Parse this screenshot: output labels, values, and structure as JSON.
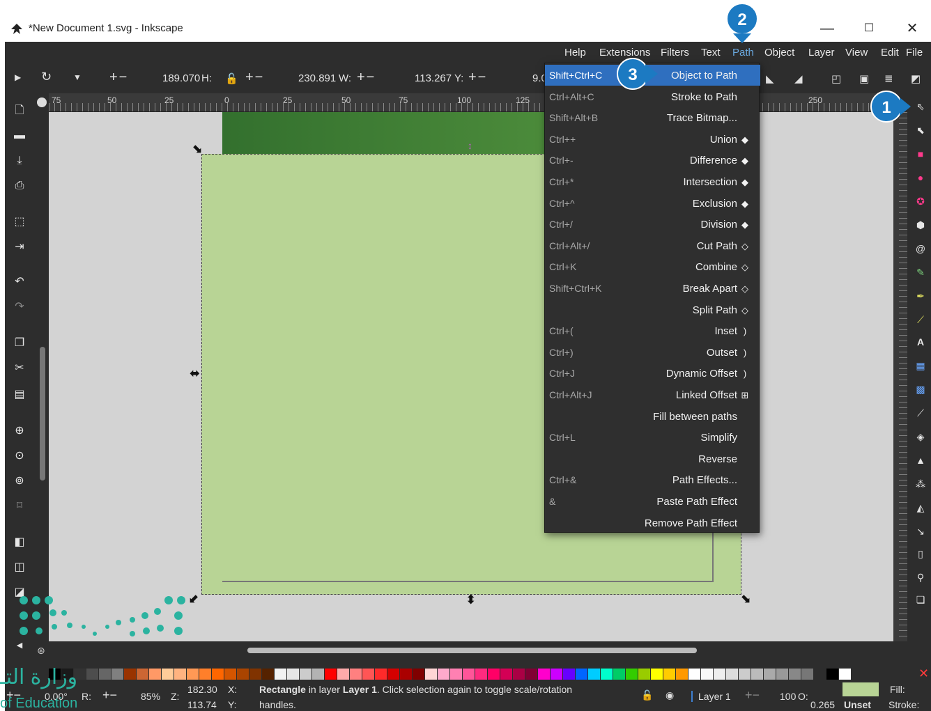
{
  "window": {
    "title": "*New Document 1.svg - Inkscape",
    "minimize": "—",
    "maximize": "☐",
    "close": "✕"
  },
  "menubar": {
    "items": [
      "Help",
      "Extensions",
      "Filters",
      "Text",
      "Path",
      "Object",
      "Layer",
      "View",
      "Edit",
      "File"
    ]
  },
  "toolcontrols": {
    "h_value": "189.070",
    "h_label": "H:",
    "w_value": "230.891",
    "w_label": "W:",
    "y_value": "113.267",
    "y_label": "Y:",
    "x_value_partial": "9.0",
    "plusminus": "+−"
  },
  "ruler": {
    "labels": [
      "75",
      "50",
      "25",
      "0",
      "25",
      "50",
      "75",
      "100",
      "125",
      "250"
    ]
  },
  "path_menu": {
    "items": [
      {
        "shortcut": "Shift+Ctrl+C",
        "label": "Object to Path",
        "icon": ""
      },
      {
        "shortcut": "Ctrl+Alt+C",
        "label": "Stroke to Path",
        "icon": ""
      },
      {
        "shortcut": "Shift+Alt+B",
        "label": "Trace Bitmap...",
        "icon": ""
      },
      {
        "shortcut": "Ctrl++",
        "label": "Union",
        "icon": "◆"
      },
      {
        "shortcut": "Ctrl+-",
        "label": "Difference",
        "icon": "◆"
      },
      {
        "shortcut": "Ctrl+*",
        "label": "Intersection",
        "icon": "◆"
      },
      {
        "shortcut": "Ctrl+^",
        "label": "Exclusion",
        "icon": "◆"
      },
      {
        "shortcut": "Ctrl+/",
        "label": "Division",
        "icon": "◆"
      },
      {
        "shortcut": "Ctrl+Alt+/",
        "label": "Cut Path",
        "icon": "◇"
      },
      {
        "shortcut": "Ctrl+K",
        "label": "Combine",
        "icon": "◇"
      },
      {
        "shortcut": "Shift+Ctrl+K",
        "label": "Break Apart",
        "icon": "◇"
      },
      {
        "shortcut": "",
        "label": "Split Path",
        "icon": "◇"
      },
      {
        "shortcut": "Ctrl+(",
        "label": "Inset",
        "icon": ")"
      },
      {
        "shortcut": "Ctrl+)",
        "label": "Outset",
        "icon": ")"
      },
      {
        "shortcut": "Ctrl+J",
        "label": "Dynamic Offset",
        "icon": ")"
      },
      {
        "shortcut": "Ctrl+Alt+J",
        "label": "Linked Offset",
        "icon": "⊞"
      },
      {
        "shortcut": "",
        "label": "Fill between paths",
        "icon": ""
      },
      {
        "shortcut": "Ctrl+L",
        "label": "Simplify",
        "icon": ""
      },
      {
        "shortcut": "",
        "label": "Reverse",
        "icon": ""
      },
      {
        "shortcut": "Ctrl+&",
        "label": "Path Effects...",
        "icon": ""
      },
      {
        "shortcut": "&",
        "label": "Paste Path Effect",
        "icon": ""
      },
      {
        "shortcut": "",
        "label": "Remove Path Effect",
        "icon": ""
      }
    ]
  },
  "callouts": {
    "one": "1",
    "two": "2",
    "three": "3"
  },
  "statusbar": {
    "rotation": "0.00°",
    "r_label": "R:",
    "zoom": "85%",
    "z_label": "Z:",
    "x_coord": "182.30",
    "x_label": "X:",
    "y_coord": "113.74",
    "y_label": "Y:",
    "msg_object": "Rectangle",
    "msg_in_layer": "in layer",
    "msg_layer": "Layer 1",
    "msg_rest": ". Click selection again to toggle scale/rotation",
    "msg_line2": "handles.",
    "layer_name": "Layer 1",
    "opacity": "100",
    "o_label": "O:",
    "stroke_width": "0.265",
    "stroke_value": "Unset",
    "fill_label": "Fill:",
    "stroke_label": "Stroke:",
    "plusminus": "+−"
  },
  "colors": {
    "chrome": "#2d2d2d",
    "canvas": "#d3d3d3",
    "selection_fill": "#b8d495",
    "menu_highlight": "#2f6fbf",
    "callout": "#1c7ac2",
    "palette": [
      "#000000",
      "#1a1a1a",
      "#333333",
      "#4d4d4d",
      "#666666",
      "#808080",
      "#993300",
      "#cc6633",
      "#ff9966",
      "#ffcc99",
      "#ffb380",
      "#ff9955",
      "#ff7f2a",
      "#ff6600",
      "#d45500",
      "#aa4400",
      "#803300",
      "#552200",
      "#f2f2f2",
      "#e6e6e6",
      "#cccccc",
      "#b3b3b3",
      "#ff0000",
      "#ffaaaa",
      "#ff8080",
      "#ff5555",
      "#ff2a2a",
      "#d40000",
      "#aa0000",
      "#800000",
      "#ffd5d5",
      "#ffaacc",
      "#ff80b2",
      "#ff5599",
      "#ff2a7f",
      "#ff0066",
      "#d40055",
      "#aa0044",
      "#800033",
      "#ff00cc",
      "#cc00ff",
      "#6600ff",
      "#0066ff",
      "#00ccff",
      "#00ffcc",
      "#00cc66",
      "#33cc00",
      "#99cc00",
      "#ffff00",
      "#ffcc00",
      "#ff9900",
      "#ffffff",
      "#f9f9f9",
      "#eeeeee",
      "#dddddd",
      "#cccccc",
      "#bbbbbb",
      "#aaaaaa",
      "#999999",
      "#888888",
      "#777777",
      "#2d2d2d",
      "#000000",
      "#ffffff"
    ]
  },
  "watermark": {
    "arabic": "وزارة التـ",
    "english": "of Education"
  }
}
